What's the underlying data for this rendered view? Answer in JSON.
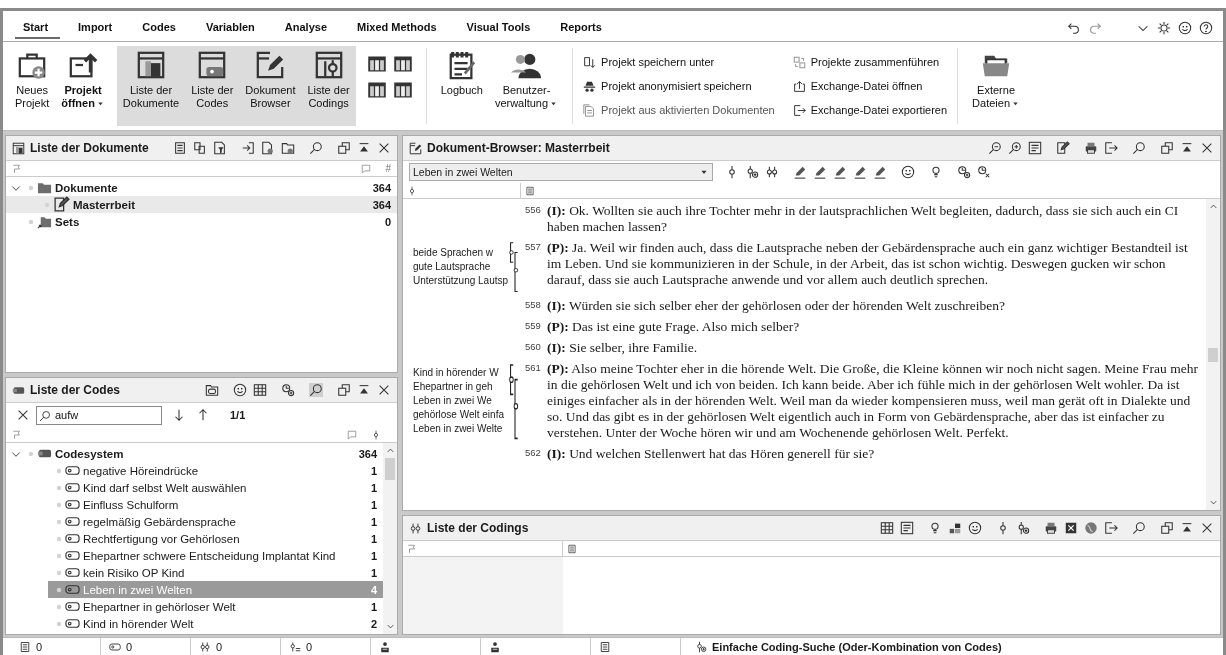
{
  "tabs": [
    {
      "label": "Start",
      "selected": true
    },
    {
      "label": "Import",
      "selected": false
    },
    {
      "label": "Codes",
      "selected": false
    },
    {
      "label": "Variablen",
      "selected": false
    },
    {
      "label": "Analyse",
      "selected": false
    },
    {
      "label": "Mixed Methods",
      "selected": false
    },
    {
      "label": "Visual Tools",
      "selected": false
    },
    {
      "label": "Reports",
      "selected": false
    }
  ],
  "ribbon": {
    "files": [
      {
        "lines": [
          "Neues",
          "Projekt"
        ],
        "dropdown": false
      },
      {
        "lines": [
          "Projekt",
          "öffnen"
        ],
        "dropdown": true
      }
    ],
    "views": [
      {
        "lines": [
          "Liste der",
          "Dokumente"
        ],
        "selected": true
      },
      {
        "lines": [
          "Liste der",
          "Codes"
        ],
        "selected": true
      },
      {
        "lines": [
          "Dokument",
          "Browser"
        ],
        "selected": true
      },
      {
        "lines": [
          "Liste der",
          "Codings"
        ],
        "selected": true
      }
    ],
    "tools": [
      {
        "lines": [
          "Logbuch"
        ],
        "dropdown": false
      },
      {
        "lines": [
          "Benutzer-",
          "verwaltung"
        ],
        "dropdown": true
      }
    ],
    "links": [
      {
        "label": "Projekt speichern unter",
        "disabled": false
      },
      {
        "label": "Projekt anonymisiert speichern",
        "disabled": false
      },
      {
        "label": "Projekt aus aktivierten Dokumenten",
        "disabled": true
      },
      {
        "label": "Projekte zusammenführen",
        "disabled": false
      },
      {
        "label": "Exchange-Datei öffnen",
        "disabled": false
      },
      {
        "label": "Exchange-Datei exportieren",
        "disabled": false
      }
    ],
    "external": [
      {
        "lines": [
          "Externe",
          "Dateien"
        ],
        "dropdown": true
      }
    ]
  },
  "documents": {
    "title": "Liste der Dokumente",
    "count_header": "#",
    "rows": [
      {
        "label": "Dokumente",
        "count": "364",
        "kind": "folder",
        "expanded": true,
        "selected": false,
        "children": [
          {
            "label": "Masterrbeit",
            "count": "364",
            "kind": "document",
            "selected": true
          }
        ]
      },
      {
        "label": "Sets",
        "count": "0",
        "kind": "sets",
        "selected": false
      }
    ]
  },
  "codes": {
    "title": "Liste der Codes",
    "search": {
      "value": "aufw",
      "matches": "1/1"
    },
    "rows": [
      {
        "label": "Codesystem",
        "count": "364",
        "expanded": true,
        "selected": false,
        "children": [
          {
            "label": "negative Höreindrücke",
            "count": "1",
            "selected": false
          },
          {
            "label": "Kind darf selbst Welt auswählen",
            "count": "1",
            "selected": false
          },
          {
            "label": "Einfluss Schulform",
            "count": "1",
            "selected": false
          },
          {
            "label": "regelmäßig Gebärdensprache",
            "count": "1",
            "selected": false
          },
          {
            "label": "Rechtfertigung vor Gehörlosen",
            "count": "1",
            "selected": false
          },
          {
            "label": "Ehepartner schwere Entscheidung Implantat Kind",
            "count": "1",
            "selected": false
          },
          {
            "label": "kein Risiko OP Kind",
            "count": "1",
            "selected": false
          },
          {
            "label": "Leben in zwei Welten",
            "count": "4",
            "selected": true
          },
          {
            "label": "Ehepartner in gehörloser Welt",
            "count": "1",
            "selected": false
          },
          {
            "label": "Kind in hörender Welt",
            "count": "2",
            "selected": false
          }
        ]
      }
    ]
  },
  "browser": {
    "title": "Dokument-Browser: Masterrbeit",
    "code_select": "Leben in zwei Welten",
    "paragraphs": [
      {
        "number": "556",
        "text": "**(I):** Ok. Wollten sie auch ihre Tochter mehr in der lautsprachlichen Welt begleiten, dadurch, dass sie sich auch ein CI haben machen lassen?"
      },
      {
        "number": "557",
        "text": "**(P):** Ja. Weil wir finden auch, dass die Lautsprache neben der Gebärdensprache auch ein ganz wichtiger Bestandteil ist im Leben. Und sie kommunizieren in der Schule, in der Arbeit, das ist schon wichtig. Deswegen gucken wir schon darauf, dass sie auch Lautsprache anwende und vor allem auch deutlich sprechen.",
        "codings": [
          "beide Sprachen w",
          "gute Lautsprache",
          "Unterstützung Lautsp"
        ]
      },
      {
        "number": "558",
        "text": "**(I):** Würden sie sich selber eher der gehörlosen oder der hörenden Welt zuschreiben?"
      },
      {
        "number": "559",
        "text": "**(P):** Das ist eine gute Frage. Also mich selber?"
      },
      {
        "number": "560",
        "text": "**(I):** Sie selber, ihre Familie."
      },
      {
        "number": "561",
        "text": "**(P):** Also meine Tochter eher in die hörende Welt. Die Große, die Kleine können wir noch nicht sagen. Meine Frau mehr in die gehörlosen Welt und ich von beiden. Ich kann beide. Aber ich fühle mich in der gehörlosen Welt wohler. Da ist einiges einfacher als in der hörenden Welt. Weil man da wieder kompensieren muss, weil man gerät oft in Dialekte und so. Und das gibt es in der gehörlosen Welt eigentlich auch in Form von Gebärdensprache, aber das ist einfacher zu verstehen. Unter der Woche hören wir und am Wochenende gehörlosen Welt. Perfekt.",
        "codings": [
          "Kind in hörender W",
          "Ehepartner in geh",
          "Leben in zwei We",
          "gehörlose Welt einfa",
          "Leben in zwei Welte"
        ]
      },
      {
        "number": "562",
        "text": "**(I):** Und welchen Stellenwert hat das Hören generell für sie?"
      }
    ]
  },
  "codings": {
    "title": "Liste der Codings"
  },
  "status_bar": {
    "counters": [
      {
        "value": "0"
      },
      {
        "value": "0"
      },
      {
        "value": "0"
      },
      {
        "value": "0"
      }
    ],
    "search": "Einfache Coding-Suche (Oder-Kombination von Codes)"
  }
}
